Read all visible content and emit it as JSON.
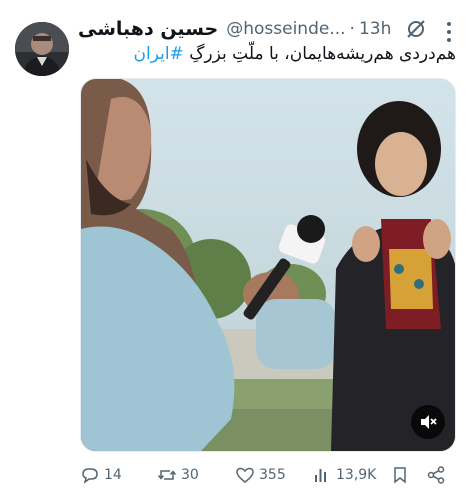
{
  "author": {
    "name": "حسین دهباشی",
    "handle": "@hosseinde...",
    "separator": "·",
    "time": "13h"
  },
  "tweet": {
    "text_plain": "هم‌دردی هم‌ریشه‌هایمان، با ملّتِ بزرگِ ",
    "hashtag": "#ایران"
  },
  "actions": {
    "replies": "14",
    "retweets": "30",
    "likes": "355",
    "views": "13,9K"
  },
  "icons": {
    "more": "more-icon",
    "badge": "grok-badge-icon",
    "mute": "mute-icon"
  },
  "colors": {
    "text": "#0f1419",
    "secondary": "#536471",
    "link": "#1d9bf0"
  }
}
